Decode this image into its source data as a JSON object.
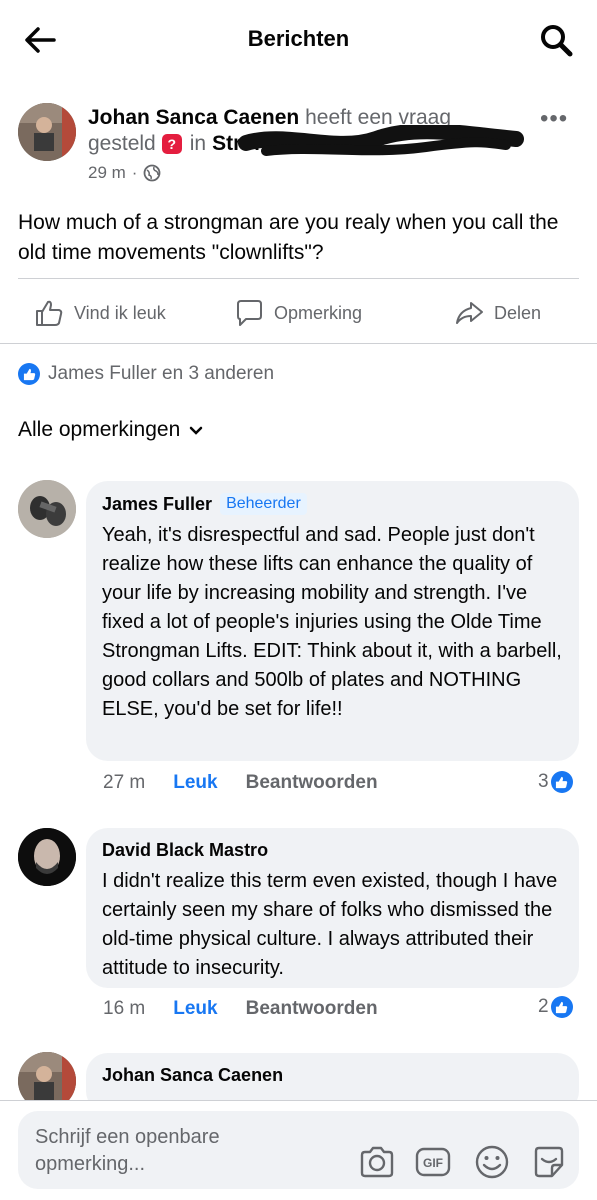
{
  "topbar": {
    "title": "Berichten",
    "back_icon": "arrow-left-icon",
    "search_icon": "search-icon"
  },
  "post": {
    "author": "Johan Sanca Caenen",
    "action_text_1": "heeft een vraag",
    "action_text_2": "gesteld",
    "in_text": "in",
    "group_visible": "Strongman",
    "time": "29 m",
    "dot": "·",
    "privacy_icon": "globe-icon",
    "body": "How much of a strongman are you realy when you call the old time movements \"clownlifts\"?"
  },
  "actions": {
    "like": "Vind ik leuk",
    "comment": "Opmerking",
    "share": "Delen"
  },
  "reactions": {
    "text": "James Fuller en 3 anderen"
  },
  "filter": {
    "label": "Alle opmerkingen"
  },
  "comments": [
    {
      "name": "James Fuller",
      "badge": "Beheerder",
      "text": "Yeah, it's disrespectful and sad. People just don't realize how these lifts can enhance the quality of your life by increasing mobility and strength. I've fixed a lot of people's injuries using the Olde Time Strongman Lifts. EDIT: Think about it, with a barbell, good collars and 500lb of plates and NOTHING ELSE, you'd be set for life!!",
      "time": "27 m",
      "like": "Leuk",
      "reply": "Beantwoorden",
      "count": "3"
    },
    {
      "name": "David Black Mastro",
      "text": "I didn't realize this term even existed, though I have certainly seen my share of folks who dismissed the old-time physical culture.  I always attributed their attitude to insecurity.",
      "time": "16 m",
      "like": "Leuk",
      "reply": "Beantwoorden",
      "count": "2"
    },
    {
      "name": "Johan Sanca Caenen"
    }
  ],
  "composer": {
    "placeholder": "Schrijf een openbare opmerking...",
    "icons": [
      "camera-icon",
      "gif-icon",
      "emoji-icon",
      "sticker-icon"
    ]
  },
  "colors": {
    "accent": "#1877f2",
    "bubble": "#f0f2f5",
    "muted": "#65676b",
    "question": "#e41e3f"
  }
}
